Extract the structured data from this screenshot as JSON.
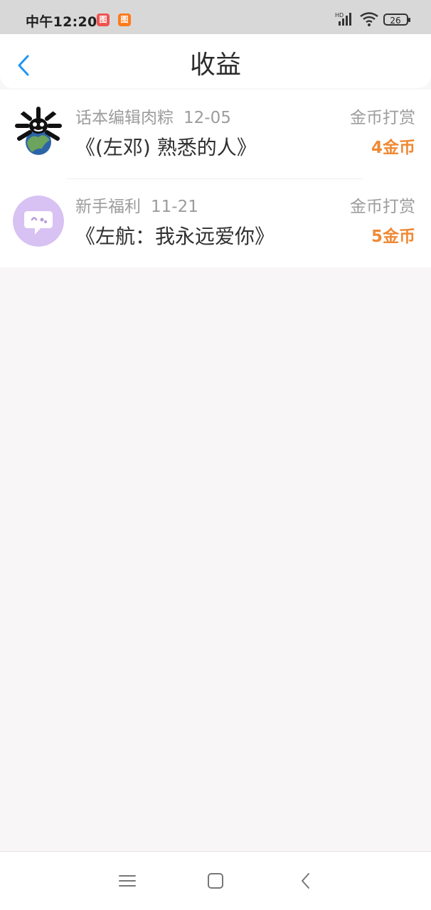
{
  "status_bar": {
    "time": "中午12:20",
    "app_badges": [
      "图",
      "图"
    ],
    "signal_label": "HD",
    "battery_value": "26"
  },
  "header": {
    "title": "收益",
    "back_icon": "chevron-left-icon",
    "accent_color": "#2196F3"
  },
  "rewards": [
    {
      "sender": "话本编辑肉粽",
      "date": "12-05",
      "title": "《(左邓) 熟悉的人》",
      "type": "金币打赏",
      "amount": "4金币",
      "avatar_icon": "earth-avatar-icon"
    },
    {
      "sender": "新手福利",
      "date": "11-21",
      "title": "《左航：我永远爱你》",
      "type": "金币打赏",
      "amount": "5金币",
      "avatar_icon": "chat-bubble-avatar-icon"
    }
  ],
  "colors": {
    "amount": "#EF8A35",
    "muted_text": "#9C9C9C",
    "background": "#F9F6F7"
  },
  "navigation": {
    "icons": [
      "menu-icon",
      "home-square-icon",
      "back-chevron-icon"
    ]
  }
}
